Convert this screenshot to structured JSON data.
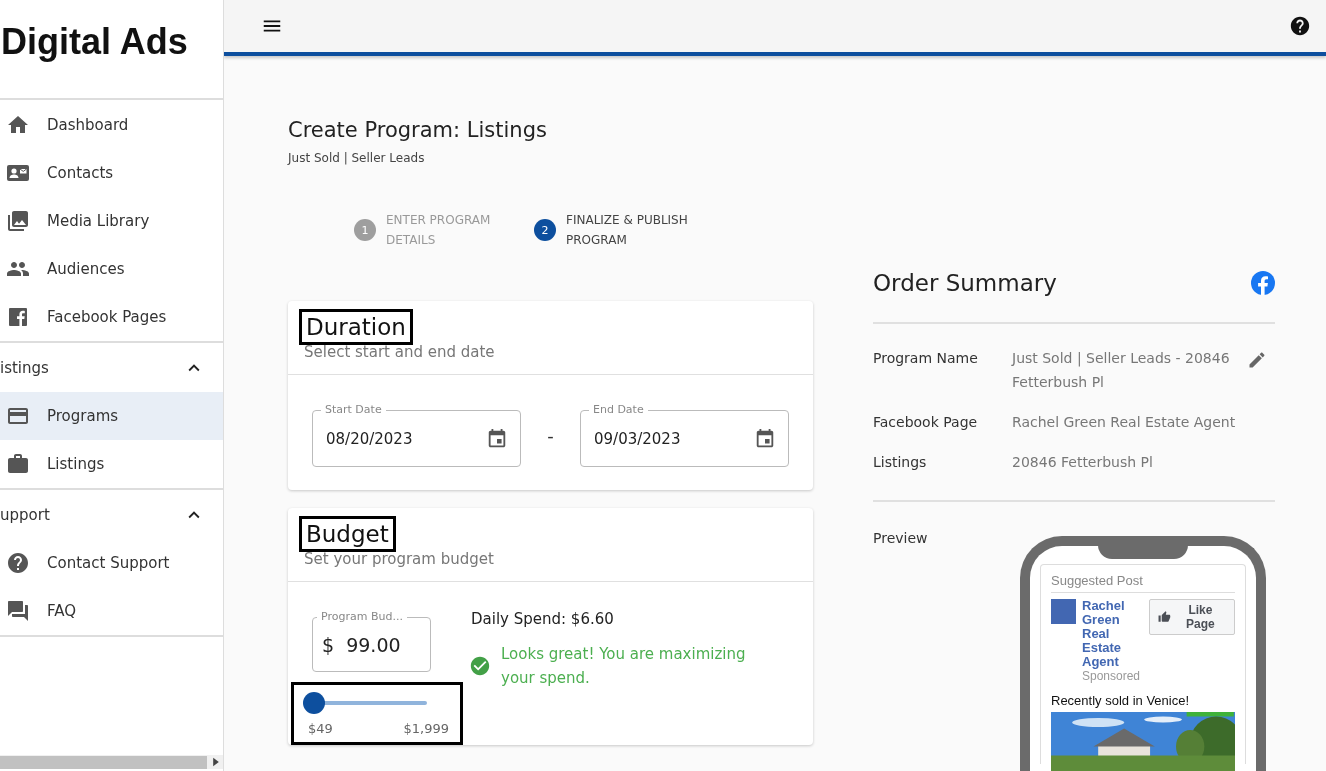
{
  "sidebar": {
    "title": "Digital Ads",
    "items": [
      {
        "label": "Dashboard",
        "selected": false
      },
      {
        "label": "Contacts",
        "selected": false
      },
      {
        "label": "Media Library",
        "selected": false
      },
      {
        "label": "Audiences",
        "selected": false
      },
      {
        "label": "Facebook Pages",
        "selected": false
      }
    ],
    "groups": [
      {
        "label": "istings",
        "expanded": true,
        "items": [
          {
            "label": "Programs",
            "selected": true
          },
          {
            "label": "Listings",
            "selected": false
          }
        ]
      },
      {
        "label": "upport",
        "expanded": true,
        "items": [
          {
            "label": "Contact Support",
            "selected": false
          },
          {
            "label": "FAQ",
            "selected": false
          }
        ]
      }
    ]
  },
  "page": {
    "title": "Create Program: Listings",
    "subtitle": "Just Sold | Seller Leads"
  },
  "stepper": [
    {
      "number": "1",
      "label": "ENTER PROGRAM DETAILS",
      "active": false
    },
    {
      "number": "2",
      "label": "FINALIZE & PUBLISH PROGRAM",
      "active": true
    }
  ],
  "duration": {
    "title": "Duration",
    "highlighted": true,
    "subtitle": "Select start and end date",
    "start": {
      "label": "Start Date",
      "value": "08/20/2023"
    },
    "separator": "-",
    "end": {
      "label": "End Date",
      "value": "09/03/2023"
    }
  },
  "budget": {
    "title": "Budget",
    "highlighted": true,
    "subtitle": "Set your program budget",
    "field": {
      "label": "Program Bud...",
      "prefix": "$",
      "value": "99.00"
    },
    "slider": {
      "level": 0.03,
      "min_label": "$49",
      "max_label": "$1,999",
      "highlighted": true
    },
    "daily_spend": "Daily Spend: $6.60",
    "status": {
      "ok": true,
      "message": "Looks great! You are maximizing your spend."
    }
  },
  "order_summary": {
    "title": "Order Summary",
    "rows": [
      {
        "label": "Program Name",
        "value": "Just Sold | Seller Leads - 20846 Fetterbush Pl",
        "editable": true
      },
      {
        "label": "Facebook Page",
        "value": "Rachel Green Real Estate Agent"
      },
      {
        "label": "Listings",
        "value": "20846 Fetterbush Pl"
      }
    ],
    "preview": {
      "label": "Preview",
      "post": {
        "header": "Suggested Post",
        "page_name": "Rachel Green Real Estate Agent",
        "sponsored": "Sponsored",
        "like_button": "Like Page",
        "text": "Recently sold in Venice!"
      }
    }
  }
}
